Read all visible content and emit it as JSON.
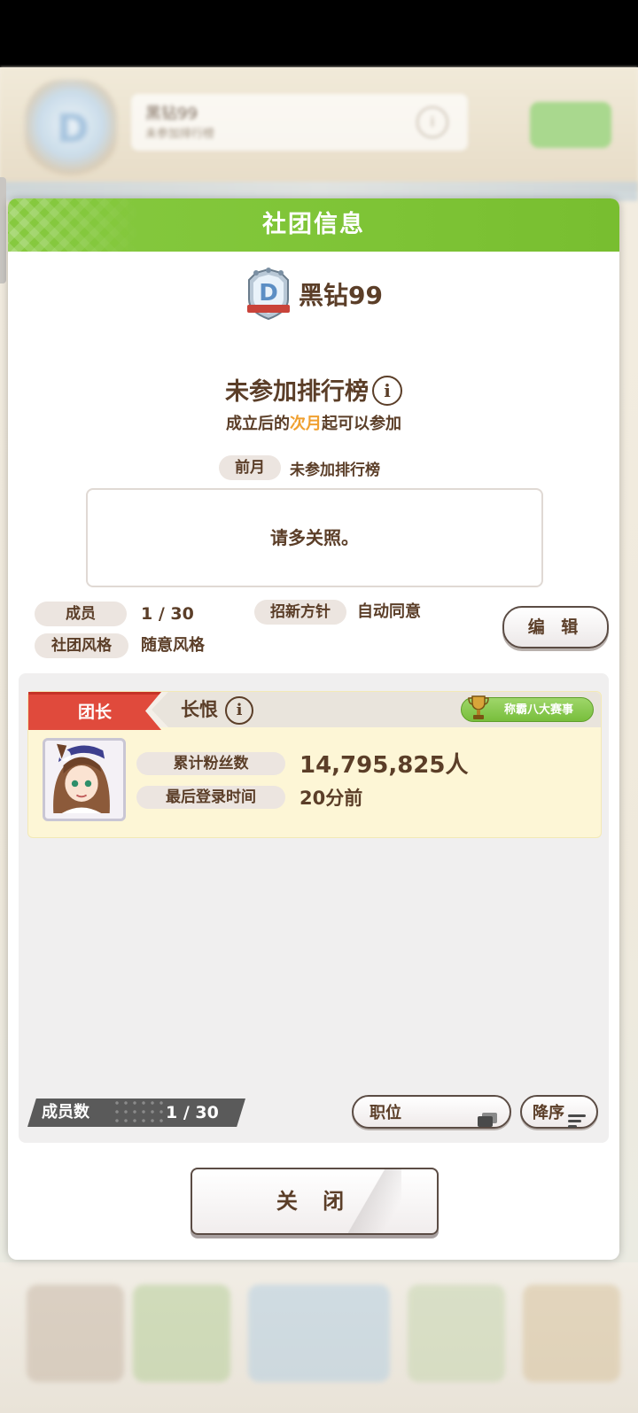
{
  "background": {
    "club_name_blurred": "黑钻99",
    "club_sub_blurred": "未参加排行榜",
    "crest_letter": "D"
  },
  "modal": {
    "title": "社团信息",
    "club_name": "黑钻99",
    "crest_letter": "D",
    "ranking": {
      "title": "未参加排行榜",
      "info_glyph": "i",
      "sub_prefix": "成立后的",
      "sub_highlight": "次月",
      "sub_suffix": "起可以参加",
      "prev_label": "前月",
      "prev_value": "未参加排行榜"
    },
    "comment": "请多关照。",
    "members_label": "成员",
    "members_value": "1 / 30",
    "policy_label": "招新方针",
    "policy_value": "自动同意",
    "style_label": "社团风格",
    "style_value": "随意风格",
    "edit_button": "编 辑",
    "leader_card": {
      "role": "团长",
      "name": "长恨",
      "info_glyph": "i",
      "title_badge": "称霸八大赛事",
      "fans_label": "累计粉丝数",
      "fans_value": "14,795,825人",
      "login_label": "最后登录时间",
      "login_value": "20分前"
    },
    "member_count_label": "成员数",
    "member_count_value": "1 / 30",
    "sort_field": "职位",
    "sort_order": "降序",
    "close_button": "关 闭"
  },
  "colors": {
    "header_green": "#7ec436",
    "text_brown": "#5b3e28",
    "highlight_orange": "#f0a030",
    "role_red": "#e04a3c"
  }
}
